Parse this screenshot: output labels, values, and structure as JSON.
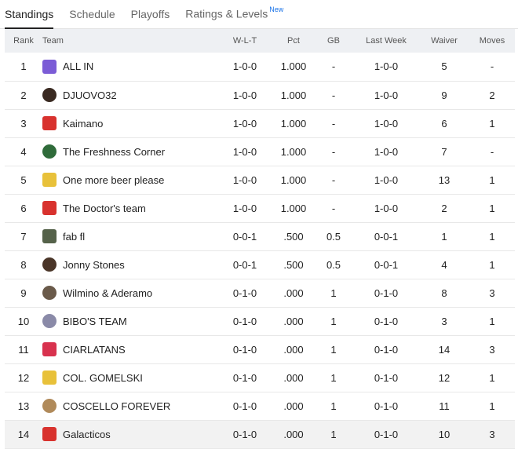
{
  "tabs": [
    {
      "label": "Standings",
      "active": true,
      "sup": ""
    },
    {
      "label": "Schedule",
      "active": false,
      "sup": ""
    },
    {
      "label": "Playoffs",
      "active": false,
      "sup": ""
    },
    {
      "label": "Ratings & Levels",
      "active": false,
      "sup": "New"
    }
  ],
  "table": {
    "headers": {
      "rank": "Rank",
      "team": "Team",
      "wlt": "W-L-T",
      "pct": "Pct",
      "gb": "GB",
      "last_week": "Last Week",
      "waiver": "Waiver",
      "moves": "Moves"
    },
    "rows": [
      {
        "rank": "1",
        "team": "ALL IN",
        "wlt": "1-0-0",
        "pct": "1.000",
        "gb": "-",
        "last_week": "1-0-0",
        "waiver": "5",
        "moves": "-",
        "logo": "jersey-icon",
        "logo_color": "#7b5cd6"
      },
      {
        "rank": "2",
        "team": "DJUOVO32",
        "wlt": "1-0-0",
        "pct": "1.000",
        "gb": "-",
        "last_week": "1-0-0",
        "waiver": "9",
        "moves": "2",
        "logo": "avatar-icon",
        "logo_color": "#3a2a22"
      },
      {
        "rank": "3",
        "team": "Kaimano",
        "wlt": "1-0-0",
        "pct": "1.000",
        "gb": "-",
        "last_week": "1-0-0",
        "waiver": "6",
        "moves": "1",
        "logo": "logo-icon",
        "logo_color": "#d8322e"
      },
      {
        "rank": "4",
        "team": "The Freshness Corner",
        "wlt": "1-0-0",
        "pct": "1.000",
        "gb": "-",
        "last_week": "1-0-0",
        "waiver": "7",
        "moves": "-",
        "logo": "avatar-icon",
        "logo_color": "#2f6b3a"
      },
      {
        "rank": "5",
        "team": "One more beer please",
        "wlt": "1-0-0",
        "pct": "1.000",
        "gb": "-",
        "last_week": "1-0-0",
        "waiver": "13",
        "moves": "1",
        "logo": "jersey-icon",
        "logo_color": "#e8c13a"
      },
      {
        "rank": "6",
        "team": "The Doctor's team",
        "wlt": "1-0-0",
        "pct": "1.000",
        "gb": "-",
        "last_week": "1-0-0",
        "waiver": "2",
        "moves": "1",
        "logo": "jersey-icon",
        "logo_color": "#d8322e"
      },
      {
        "rank": "7",
        "team": "fab fl",
        "wlt": "0-0-1",
        "pct": ".500",
        "gb": "0.5",
        "last_week": "0-0-1",
        "waiver": "1",
        "moves": "1",
        "logo": "jersey-icon",
        "logo_color": "#55624a"
      },
      {
        "rank": "8",
        "team": "Jonny Stones",
        "wlt": "0-0-1",
        "pct": ".500",
        "gb": "0.5",
        "last_week": "0-0-1",
        "waiver": "4",
        "moves": "1",
        "logo": "avatar-icon",
        "logo_color": "#4a3528"
      },
      {
        "rank": "9",
        "team": "Wilmino & Aderamo",
        "wlt": "0-1-0",
        "pct": ".000",
        "gb": "1",
        "last_week": "0-1-0",
        "waiver": "8",
        "moves": "3",
        "logo": "avatar-icon",
        "logo_color": "#6a5a4a"
      },
      {
        "rank": "10",
        "team": "BIBO'S TEAM",
        "wlt": "0-1-0",
        "pct": ".000",
        "gb": "1",
        "last_week": "0-1-0",
        "waiver": "3",
        "moves": "1",
        "logo": "badge-icon",
        "logo_color": "#8a8aa8"
      },
      {
        "rank": "11",
        "team": "CIARLATANS",
        "wlt": "0-1-0",
        "pct": ".000",
        "gb": "1",
        "last_week": "0-1-0",
        "waiver": "14",
        "moves": "3",
        "logo": "jersey-icon",
        "logo_color": "#d8324e"
      },
      {
        "rank": "12",
        "team": "COL. GOMELSKI",
        "wlt": "0-1-0",
        "pct": ".000",
        "gb": "1",
        "last_week": "0-1-0",
        "waiver": "12",
        "moves": "1",
        "logo": "jersey-icon",
        "logo_color": "#e8c13a"
      },
      {
        "rank": "13",
        "team": "COSCELLO FOREVER",
        "wlt": "0-1-0",
        "pct": ".000",
        "gb": "1",
        "last_week": "0-1-0",
        "waiver": "11",
        "moves": "1",
        "logo": "avatar-icon",
        "logo_color": "#b08a5a"
      },
      {
        "rank": "14",
        "team": "Galacticos",
        "wlt": "0-1-0",
        "pct": ".000",
        "gb": "1",
        "last_week": "0-1-0",
        "waiver": "10",
        "moves": "3",
        "logo": "jersey-icon",
        "logo_color": "#d8322e"
      }
    ]
  }
}
